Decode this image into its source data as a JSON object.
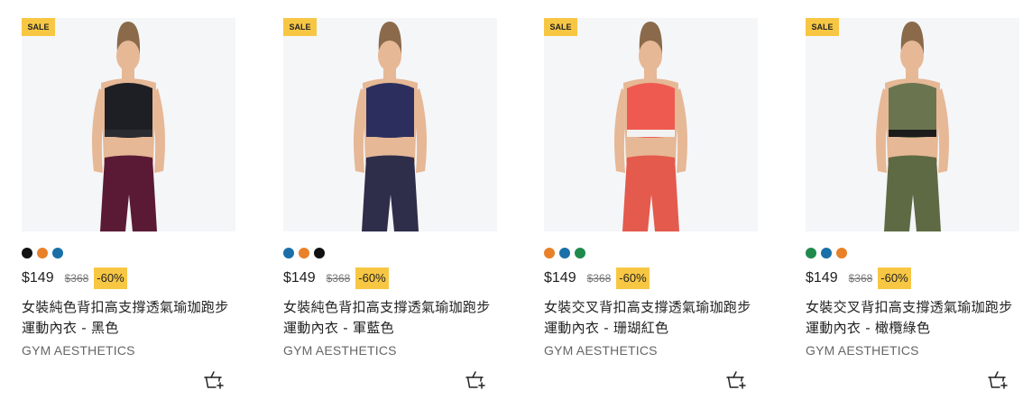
{
  "products": [
    {
      "badge": "SALE",
      "image_alt": "黑色運動內衣",
      "swatches": [
        "#111111",
        "#e8812a",
        "#1a6fa8"
      ],
      "price": "$149",
      "original_price": "$368",
      "discount": "-60%",
      "title": "女裝純色背扣高支撐透氣瑜珈跑步運動內衣 - 黑色",
      "brand": "GYM AESTHETICS",
      "colors": {
        "bra": "#1e1f24",
        "legs": "#5a1a36",
        "band": "#2b2c31",
        "skin": "#e6b896"
      }
    },
    {
      "badge": "SALE",
      "image_alt": "軍藍色運動內衣",
      "swatches": [
        "#1a6fa8",
        "#e8812a",
        "#111111"
      ],
      "price": "$149",
      "original_price": "$368",
      "discount": "-60%",
      "title": "女裝純色背扣高支撐透氣瑜珈跑步運動內衣 - 軍藍色",
      "brand": "GYM AESTHETICS",
      "colors": {
        "bra": "#2c2f5e",
        "legs": "#2e2d4a",
        "band": "#2c2f5e",
        "skin": "#e6b896"
      }
    },
    {
      "badge": "SALE",
      "image_alt": "珊瑚紅色運動內衣",
      "swatches": [
        "#e8812a",
        "#1a6fa8",
        "#1f8a4c"
      ],
      "price": "$149",
      "original_price": "$368",
      "discount": "-60%",
      "title": "女裝交叉背扣高支撐透氣瑜珈跑步運動內衣 - 珊瑚紅色",
      "brand": "GYM AESTHETICS",
      "colors": {
        "bra": "#ef5a50",
        "legs": "#e45a4c",
        "band": "#f2f2f2",
        "skin": "#e6b896"
      }
    },
    {
      "badge": "SALE",
      "image_alt": "橄欖綠色運動內衣",
      "swatches": [
        "#1f8a4c",
        "#1a6fa8",
        "#e8812a"
      ],
      "price": "$149",
      "original_price": "$368",
      "discount": "-60%",
      "title": "女裝交叉背扣高支撐透氣瑜珈跑步運動內衣 - 橄欖綠色",
      "brand": "GYM AESTHETICS",
      "colors": {
        "bra": "#6a7550",
        "legs": "#5e6a44",
        "band": "#1c1c1c",
        "skin": "#e6b896"
      }
    }
  ],
  "icons": {
    "cart": "add-to-cart-basket-icon"
  },
  "accent": "#f7c744"
}
